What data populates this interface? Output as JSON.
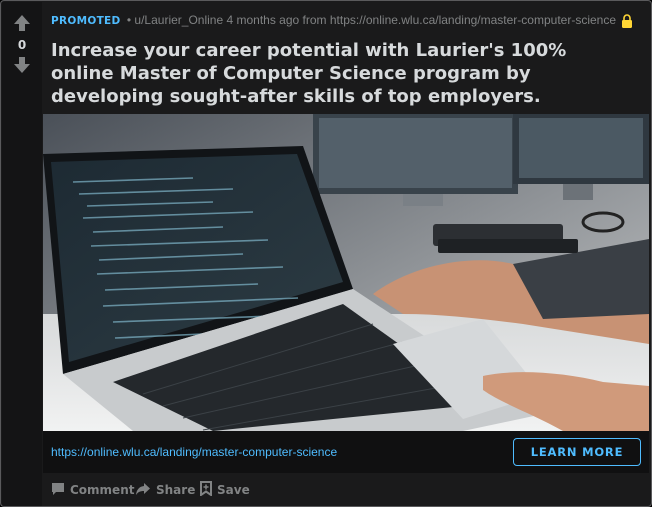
{
  "post": {
    "score": "0",
    "promoted_label": "PROMOTED",
    "meta_text": "• u/Laurier_Online 4 months ago from https://online.wlu.ca/landing/master-computer-science",
    "title": "Increase your career potential with Laurier's 100% online Master of Computer Science program by developing sought-after skills of top employers.",
    "link_url": "https://online.wlu.ca/landing/master-computer-science",
    "cta_label": "LEARN MORE"
  },
  "actions": {
    "comment": "Comment",
    "share": "Share",
    "save": "Save"
  },
  "colors": {
    "accent": "#4fbcff",
    "background": "#1a1a1b",
    "text": "#d7dadc",
    "muted": "#818384",
    "lock": "#ffd635"
  },
  "icons": [
    "upvote-icon",
    "downvote-icon",
    "lock-icon",
    "comment-icon",
    "share-icon",
    "save-icon"
  ]
}
